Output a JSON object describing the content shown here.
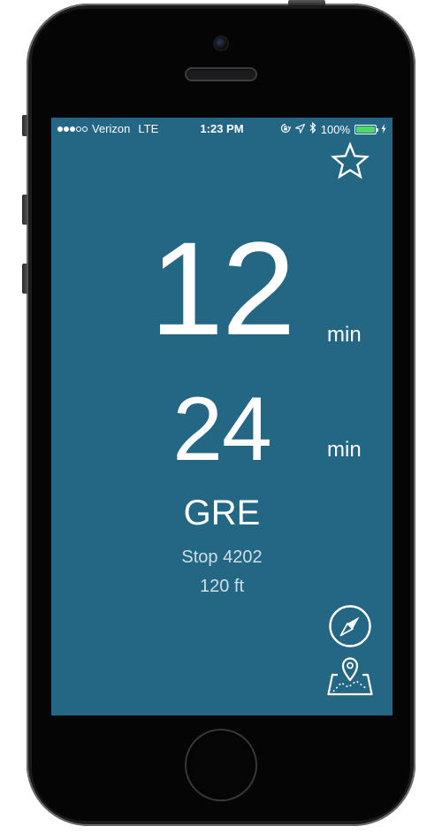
{
  "status_bar": {
    "carrier": "Verizon",
    "network": "LTE",
    "time": "1:23 PM",
    "battery": "100%",
    "signal_bars_filled": 3,
    "signal_bars_total": 5,
    "battery_level": 1.0,
    "icons": [
      "rotation-lock-icon",
      "location-arrow-icon",
      "bluetooth-icon",
      "battery-icon",
      "charging-bolt-icon"
    ]
  },
  "toolbar": {
    "favorite_icon": "star-icon"
  },
  "arrivals": [
    {
      "value": "12",
      "unit": "min"
    },
    {
      "value": "24",
      "unit": "min"
    }
  ],
  "route": {
    "name": "GRE",
    "stop": "Stop 4202",
    "distance": "120 ft"
  },
  "actions": {
    "compass_icon": "compass-icon",
    "map_icon": "map-pin-icon"
  },
  "colors": {
    "screen_background": "#236785",
    "text": "#ffffff",
    "secondary_text": "#cfdfe8",
    "battery_fill": "#4cd964"
  }
}
